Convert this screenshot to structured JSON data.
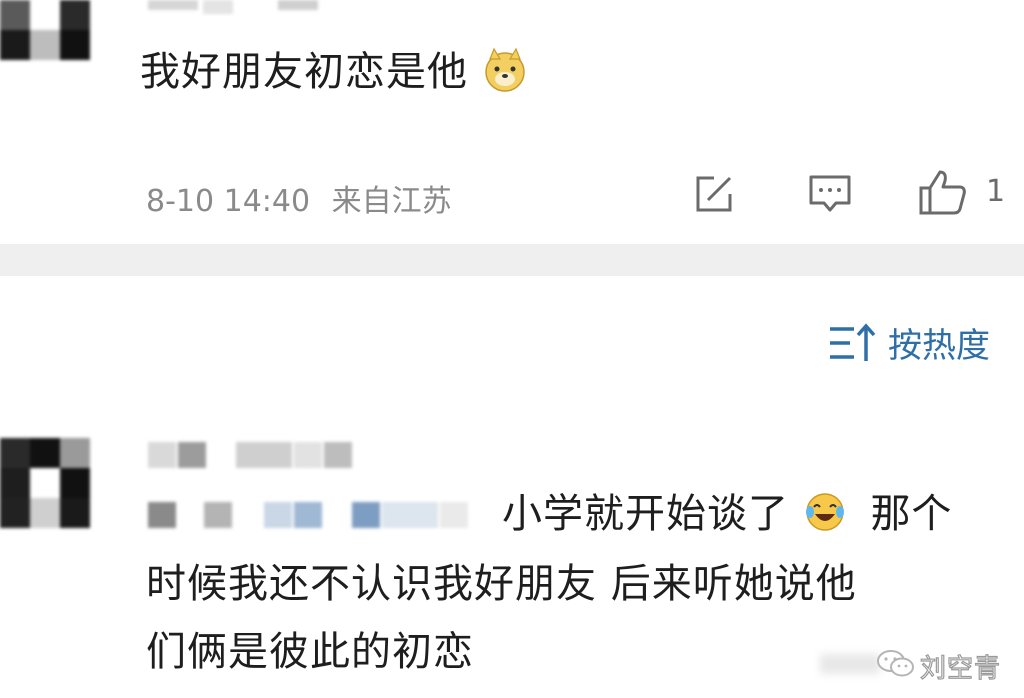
{
  "top_comment": {
    "text": "我好朋友初恋是他",
    "emoji": "doge-emoji",
    "timestamp": "8-10 14:40",
    "location": "来自江苏",
    "like_count": "1",
    "icons": [
      "share-icon",
      "reply-icon",
      "like-icon"
    ]
  },
  "sort": {
    "label": "按热度",
    "icon": "sort-icon"
  },
  "second_comment": {
    "text_line1": "小学就开始谈了",
    "text_line1_after": "那个",
    "text_line2": "时候我还不认识我好朋友 后来听她说他",
    "text_line3": "们俩是彼此的初恋",
    "emoji": "laugh-cry-emoji"
  },
  "watermark": {
    "text": "刘空青",
    "icon": "wechat-icon"
  },
  "colors": {
    "accent": "#2f6fa8",
    "meta_gray": "#8a8a8a",
    "divider": "#efefef"
  }
}
